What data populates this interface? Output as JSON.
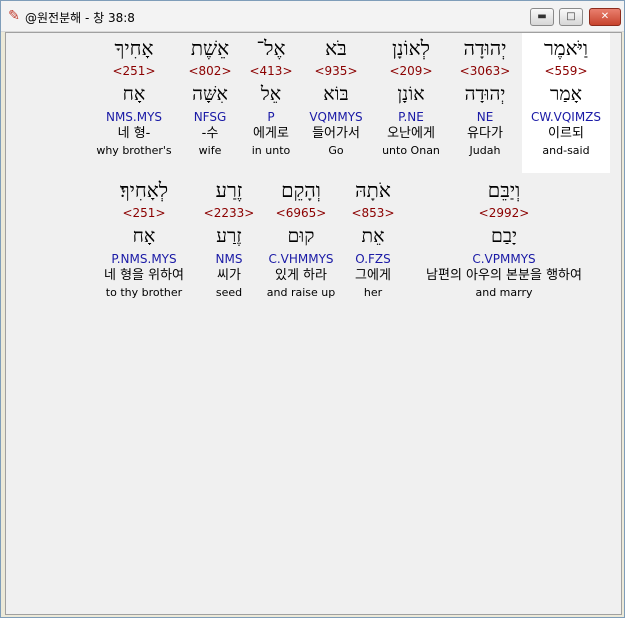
{
  "window": {
    "title": "@원전분해 - 창 38:8",
    "buttons": {
      "minimize": "▬",
      "maximize": "□",
      "close": "✕"
    }
  },
  "rows": [
    {
      "words": [
        {
          "heb": "אָחִיךָ",
          "strong": "<251>",
          "root": "אָח",
          "morph": "NMS.MYS",
          "kor": "네 형-",
          "eng": "why brother's"
        },
        {
          "heb": "אֵשֶׁת",
          "strong": "<802>",
          "root": "אִשָּׁה",
          "morph": "NFSG",
          "kor": "-수",
          "eng": "wife"
        },
        {
          "heb": "אֶל־",
          "strong": "<413>",
          "root": "אֵל",
          "morph": "P",
          "kor": "에게로",
          "eng": "in unto"
        },
        {
          "heb": "בֹּא",
          "strong": "<935>",
          "root": "בּוֹא",
          "morph": "VQMMYS",
          "kor": "들어가서",
          "eng": "Go"
        },
        {
          "heb": "לְאוֹנָן",
          "strong": "<209>",
          "root": "אוֹנָן",
          "morph": "P.NE",
          "kor": "오난에게",
          "eng": "unto Onan"
        },
        {
          "heb": "יְהוּדָה",
          "strong": "<3063>",
          "root": "יְהוּדָה",
          "morph": "NE",
          "kor": "유다가",
          "eng": "Judah"
        },
        {
          "heb": "וַיֹּאמֶר",
          "strong": "<559>",
          "root": "אָמַר",
          "morph": "CW.VQIMZS",
          "kor": "이르되",
          "eng": "and-said"
        }
      ]
    },
    {
      "words": [
        {
          "heb": "לְאָחִיךָ׃",
          "strong": "<251>",
          "root": "אָח",
          "morph": "P.NMS.MYS",
          "kor": "네 형을 위하여",
          "eng": "to thy brother"
        },
        {
          "heb": "זֶרַע",
          "strong": "<2233>",
          "root": "זֶרַע",
          "morph": "NMS",
          "kor": "씨가",
          "eng": "seed"
        },
        {
          "heb": "וְהָקֵם",
          "strong": "<6965>",
          "root": "קוּם",
          "morph": "C.VHMMYS",
          "kor": "있게 하라",
          "eng": "and raise up"
        },
        {
          "heb": "אֹתָהּ",
          "strong": "<853>",
          "root": "אֵת",
          "morph": "O.FZS",
          "kor": "그에게",
          "eng": "her"
        },
        {
          "heb": "וְיַבֵּם",
          "strong": "<2992>",
          "root": "יָבַם",
          "morph": "C.VPMMYS",
          "kor": "남편의 아우의 본분을 행하여",
          "eng": "and marry"
        }
      ]
    }
  ]
}
